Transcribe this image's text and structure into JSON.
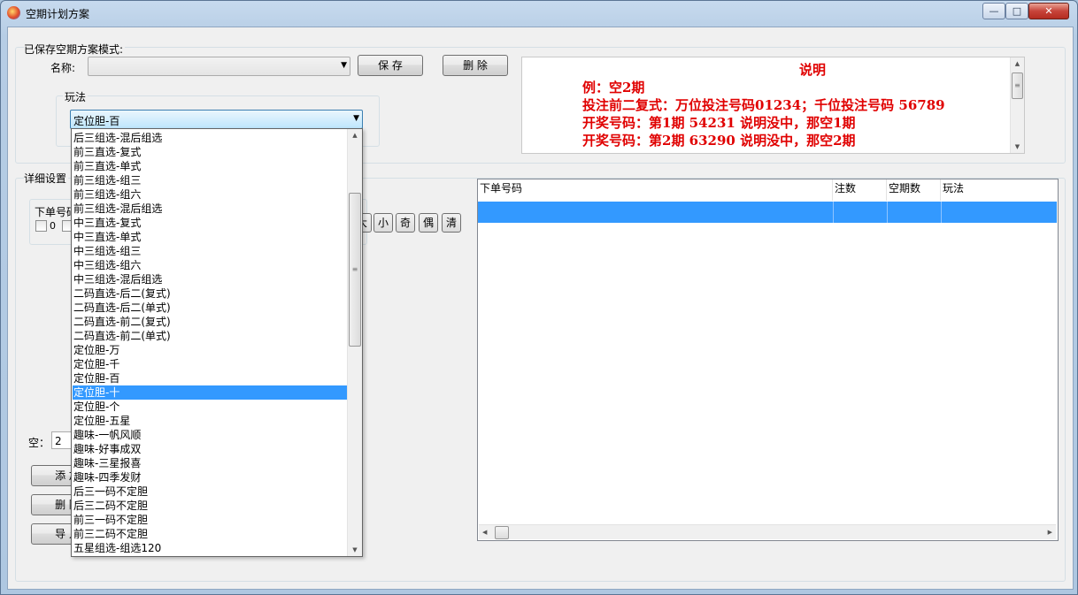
{
  "window": {
    "title": "空期计划方案",
    "min_glyph": "—",
    "max_glyph": "□",
    "close_glyph": "✕"
  },
  "saved": {
    "group_label": "已保存空期方案模式:",
    "name_label": "名称:",
    "name_value": "",
    "save_button": "保 存",
    "delete_button": "删 除"
  },
  "play": {
    "label": "玩法",
    "selected": "定位胆-百"
  },
  "description": {
    "title": "说明",
    "lines": [
      "例：空2期",
      "投注前二复式：万位投注号码01234；千位投注号码 56789",
      "开奖号码：第1期  54231  说明没中，那空1期",
      "开奖号码：第2期  63290  说明没中，那空2期"
    ]
  },
  "detail": {
    "label": "详细设置",
    "order_label": "下单号码",
    "checkbox_zero": "0",
    "quick_buttons": [
      "小",
      "奇",
      "偶",
      "清"
    ],
    "partial_button": "大",
    "empty_label": "空：",
    "empty_value": "2",
    "add_button": "添 加",
    "remove_button": "删 除",
    "import_button": "导 入"
  },
  "grid": {
    "columns": [
      "下单号码",
      "注数",
      "空期数",
      "玩法"
    ]
  },
  "dropdown": {
    "items": [
      "后三组选-混后组选",
      "前三直选-复式",
      "前三直选-单式",
      "前三组选-组三",
      "前三组选-组六",
      "前三组选-混后组选",
      "中三直选-复式",
      "中三直选-单式",
      "中三组选-组三",
      "中三组选-组六",
      "中三组选-混后组选",
      "二码直选-后二(复式)",
      "二码直选-后二(单式)",
      "二码直选-前二(复式)",
      "二码直选-前二(单式)",
      "定位胆-万",
      "定位胆-千",
      "定位胆-百",
      "定位胆-十",
      "定位胆-个",
      "定位胆-五星",
      "趣味-一帆风顺",
      "趣味-好事成双",
      "趣味-三星报喜",
      "趣味-四季发财",
      "后三一码不定胆",
      "后三二码不定胆",
      "前三一码不定胆",
      "前三二码不定胆",
      "五星组选-组选120"
    ],
    "highlighted_index": 18
  }
}
